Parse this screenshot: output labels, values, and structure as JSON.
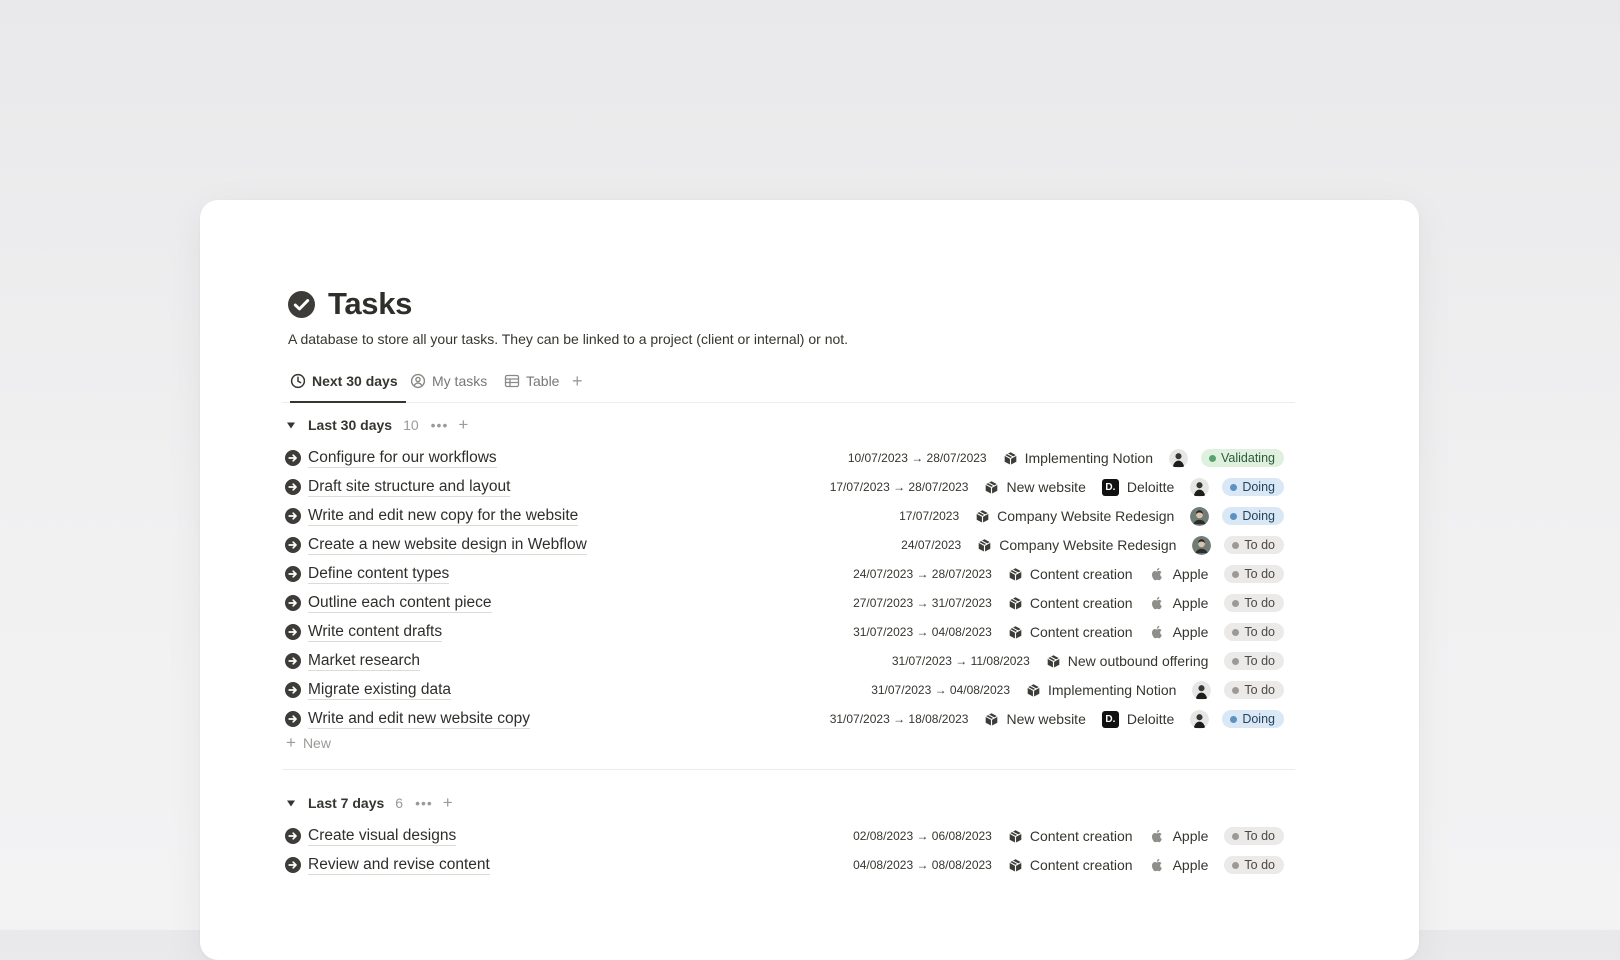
{
  "page": {
    "title": "Tasks",
    "description": "A database to store all your tasks. They can be linked to a project (client or internal) or not."
  },
  "tabs": [
    {
      "label": "Next 30 days",
      "icon": "clock-icon",
      "active": true
    },
    {
      "label": "My tasks",
      "icon": "person-circle-icon",
      "active": false
    },
    {
      "label": "Table",
      "icon": "table-icon",
      "active": false
    }
  ],
  "groups": [
    {
      "title": "Last 30 days",
      "count": "10",
      "tasks": [
        {
          "name": "Configure for our workflows",
          "date": "10/07/2023 → 28/07/2023",
          "project": "Implementing Notion",
          "client": "",
          "avatar": "a",
          "status": "Validating"
        },
        {
          "name": "Draft site structure and layout",
          "date": "17/07/2023 → 28/07/2023",
          "project": "New website",
          "client": "Deloitte",
          "avatar": "a",
          "status": "Doing"
        },
        {
          "name": "Write and edit new copy for the website",
          "date": "17/07/2023",
          "project": "Company Website Redesign",
          "client": "",
          "avatar": "b",
          "status": "Doing"
        },
        {
          "name": "Create a new website design in Webflow",
          "date": "24/07/2023",
          "project": "Company Website Redesign",
          "client": "",
          "avatar": "b",
          "status": "To do"
        },
        {
          "name": "Define content types",
          "date": "24/07/2023 → 28/07/2023",
          "project": "Content creation",
          "client": "Apple",
          "avatar": "",
          "status": "To do"
        },
        {
          "name": "Outline each content piece",
          "date": "27/07/2023 → 31/07/2023",
          "project": "Content creation",
          "client": "Apple",
          "avatar": "",
          "status": "To do"
        },
        {
          "name": "Write content drafts",
          "date": "31/07/2023 → 04/08/2023",
          "project": "Content creation",
          "client": "Apple",
          "avatar": "",
          "status": "To do"
        },
        {
          "name": "Market research",
          "date": "31/07/2023 → 11/08/2023",
          "project": "New outbound offering",
          "client": "",
          "avatar": "",
          "status": "To do"
        },
        {
          "name": "Migrate existing data",
          "date": "31/07/2023 → 04/08/2023",
          "project": "Implementing Notion",
          "client": "",
          "avatar": "a",
          "status": "To do"
        },
        {
          "name": "Write and edit new website copy",
          "date": "31/07/2023 → 18/08/2023",
          "project": "New website",
          "client": "Deloitte",
          "avatar": "a",
          "status": "Doing"
        }
      ],
      "new_label": "New"
    },
    {
      "title": "Last 7 days",
      "count": "6",
      "tasks": [
        {
          "name": "Create visual designs",
          "date": "02/08/2023 → 06/08/2023",
          "project": "Content creation",
          "client": "Apple",
          "avatar": "",
          "status": "To do"
        },
        {
          "name": "Review and revise content",
          "date": "04/08/2023 → 08/08/2023",
          "project": "Content creation",
          "client": "Apple",
          "avatar": "",
          "status": "To do"
        }
      ]
    }
  ],
  "colors": {
    "validating_bg": "#dff0df",
    "doing_bg": "#d9e8f4",
    "todo_bg": "#ebeae8",
    "text": "#37352f"
  }
}
